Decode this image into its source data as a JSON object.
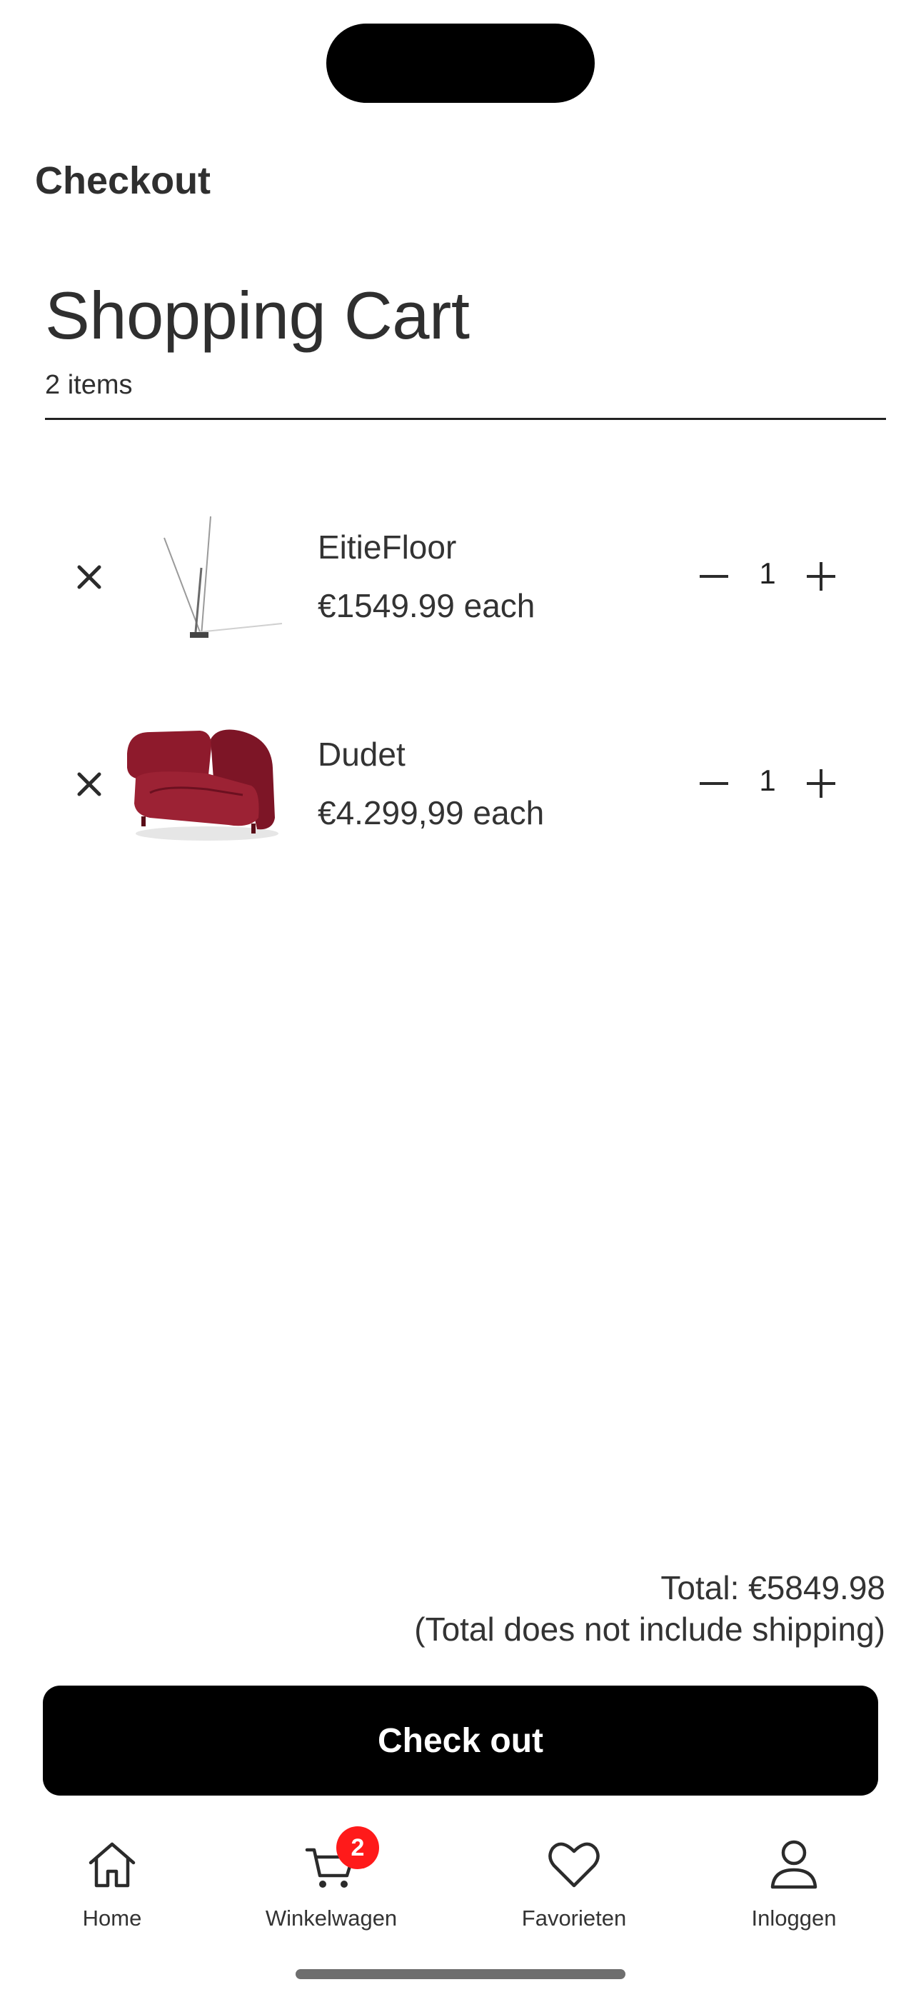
{
  "header": {
    "title": "Checkout"
  },
  "cart": {
    "title": "Shopping Cart",
    "count_text": "2 items",
    "items": [
      {
        "name": "EitieFloor",
        "price": "€1549.99 each",
        "quantity": "1",
        "image": "floor-lamp-image"
      },
      {
        "name": "Dudet",
        "price": "€4.299,99 each",
        "quantity": "1",
        "image": "red-sofa-image"
      }
    ]
  },
  "summary": {
    "total": "Total: €5849.98",
    "note": "(Total does not include shipping)"
  },
  "actions": {
    "checkout_label": "Check out"
  },
  "tabbar": {
    "tabs": [
      {
        "label": "Home",
        "icon": "home-icon"
      },
      {
        "label": "Winkelwagen",
        "icon": "cart-icon",
        "badge": "2"
      },
      {
        "label": "Favorieten",
        "icon": "heart-icon"
      },
      {
        "label": "Inloggen",
        "icon": "user-icon"
      }
    ]
  },
  "colors": {
    "accent": "#000000",
    "badge": "#ff1a1a",
    "text": "#2f2f2f",
    "sofa": "#8e1a2c"
  }
}
